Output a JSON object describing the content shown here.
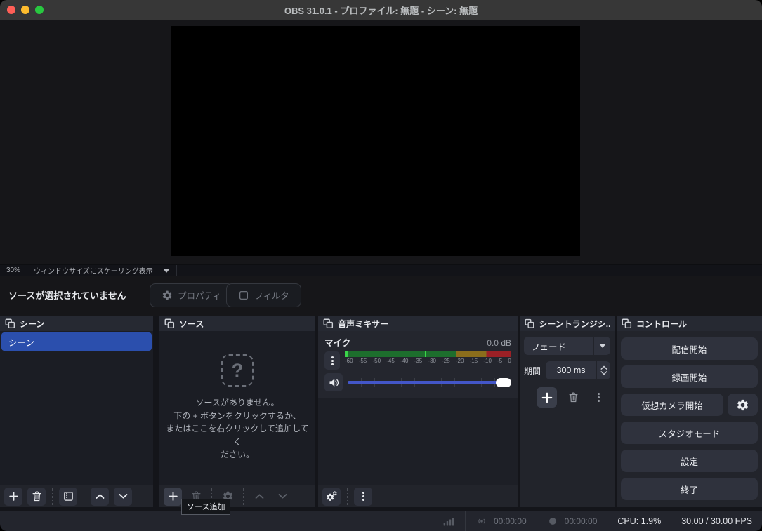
{
  "window": {
    "title": "OBS 31.0.1 - プロファイル: 無題 - シーン: 無題"
  },
  "preview": {
    "zoom": "30%",
    "scale_mode": "ウィンドウサイズにスケーリング表示"
  },
  "selection_bar": {
    "status": "ソースが選択されていません",
    "properties": "プロパティ",
    "filters": "フィルタ"
  },
  "panels": {
    "scenes": {
      "title": "シーン",
      "items": [
        {
          "label": "シーン"
        }
      ]
    },
    "sources": {
      "title": "ソース",
      "empty_lines": [
        "ソースがありません。",
        "下の + ボタンをクリックするか、",
        "またはここを右クリックして追加してく",
        "ださい。"
      ],
      "question_glyph": "?",
      "add_tooltip": "ソース追加"
    },
    "mixer": {
      "title": "音声ミキサー",
      "channel_name": "マイク",
      "level": "0.0 dB",
      "scale_ticks": [
        "-60",
        "-55",
        "-50",
        "-45",
        "-40",
        "-35",
        "-30",
        "-25",
        "-20",
        "-15",
        "-10",
        "-5",
        "0"
      ]
    },
    "transitions": {
      "title": "シーントランジシ...",
      "selected_transition": "フェード",
      "duration_label": "期間",
      "duration": "300 ms"
    },
    "controls": {
      "title": "コントロール",
      "start_streaming": "配信開始",
      "start_recording": "録画開始",
      "start_virtual_camera": "仮想カメラ開始",
      "studio_mode": "スタジオモード",
      "settings": "設定",
      "exit": "終了"
    }
  },
  "status_bar": {
    "stream_time": "00:00:00",
    "record_time": "00:00:00",
    "cpu": "CPU: 1.9%",
    "fps": "30.00 / 30.00 FPS"
  },
  "colors": {
    "accent_blue": "#2b4fad",
    "slider_blue": "#4356c8",
    "meter_green": "#1d6e2d",
    "meter_yellow": "#8a6d1c",
    "meter_red": "#9b2026"
  }
}
